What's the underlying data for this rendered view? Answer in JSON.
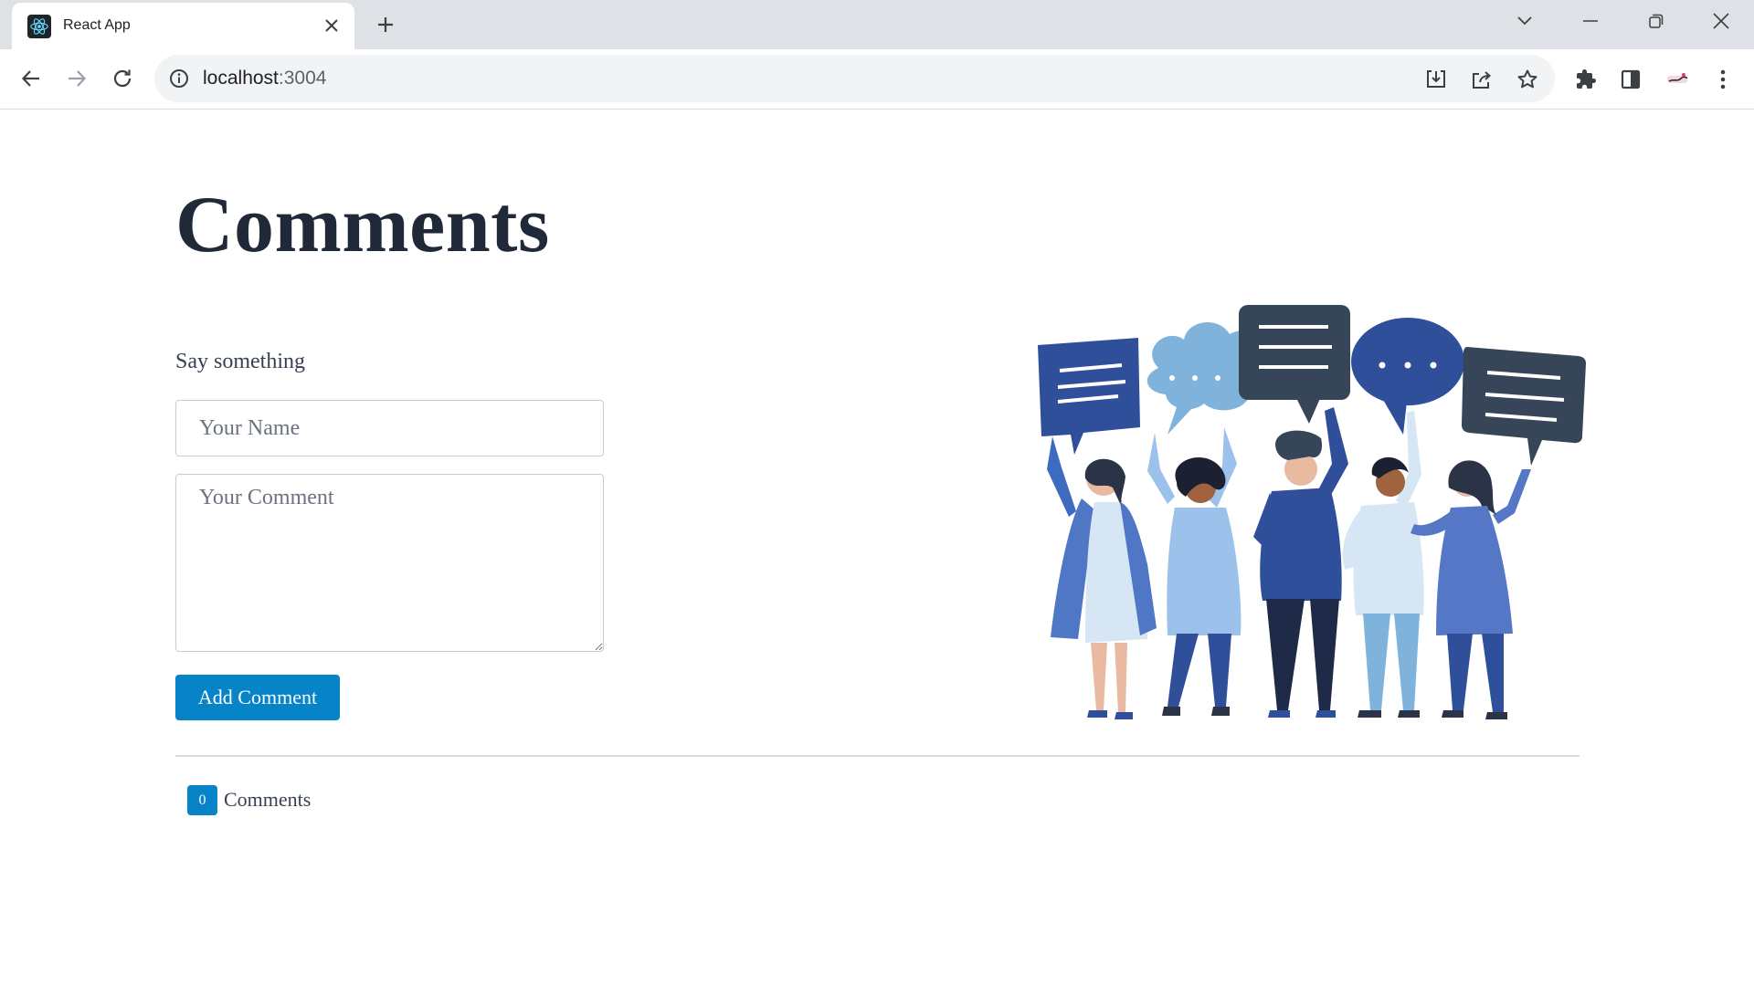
{
  "browser": {
    "tab_title": "React App",
    "url_host": "localhost",
    "url_port": ":3004"
  },
  "page": {
    "title": "Comments",
    "form_label": "Say something",
    "name_placeholder": "Your Name",
    "comment_placeholder": "Your Comment",
    "add_button": "Add Comment",
    "comment_count": "0",
    "comment_count_label": "Comments"
  },
  "colors": {
    "accent": "#0684c7",
    "heading": "#1f2937",
    "chrome": "#dee1e6"
  }
}
